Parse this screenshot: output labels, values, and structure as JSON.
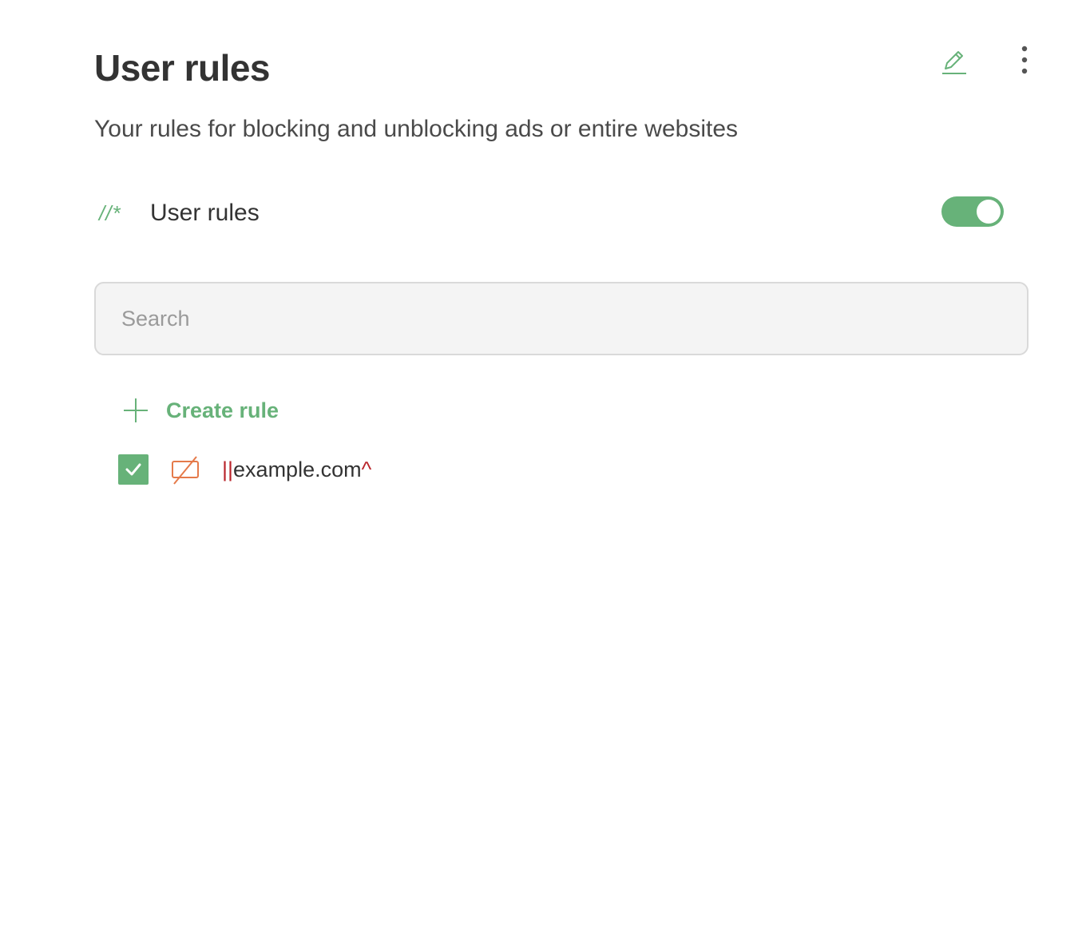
{
  "header": {
    "title": "User rules",
    "subtitle": "Your rules for blocking and unblocking ads or entire websites",
    "edit_icon": "pencil-icon",
    "more_icon": "kebab-menu-icon"
  },
  "group": {
    "icon_text": "//*",
    "label": "User rules",
    "enabled": true
  },
  "search": {
    "placeholder": "Search",
    "value": ""
  },
  "create_rule": {
    "label": "Create rule",
    "icon": "plus-icon"
  },
  "rules": [
    {
      "enabled": true,
      "type_icon": "block-ad-icon",
      "prefix": "||",
      "domain": "example.com",
      "suffix": "^"
    }
  ],
  "colors": {
    "accent": "#67b279",
    "block_icon": "#e57a4a",
    "rule_modifier": "#b9252b"
  }
}
